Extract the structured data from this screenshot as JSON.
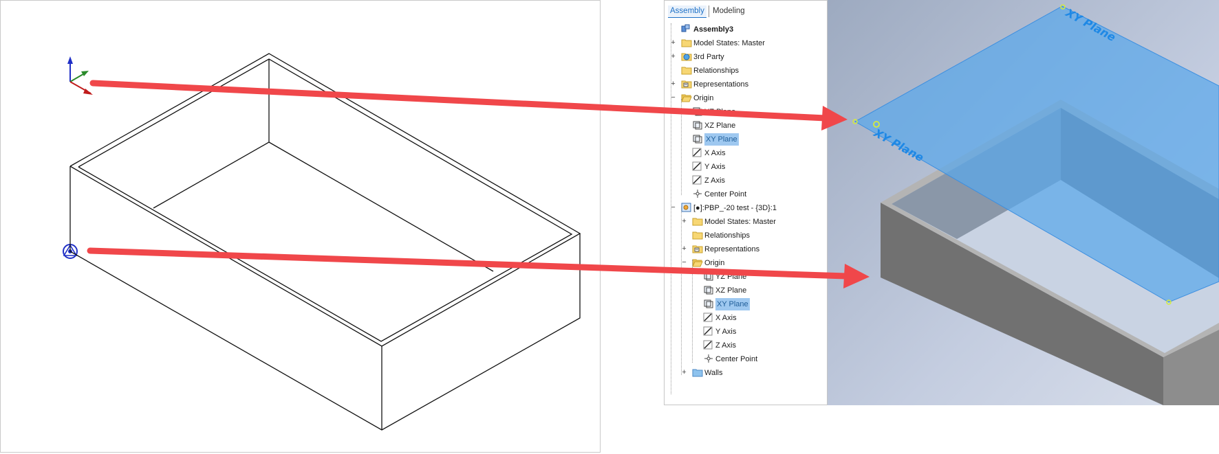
{
  "browser": {
    "tabs": [
      {
        "label": "Assembly",
        "active": true
      },
      {
        "label": "Modeling",
        "active": false
      }
    ],
    "tree": [
      {
        "label": "Assembly3",
        "icon": "assembly-icon",
        "bold": true
      },
      {
        "label": "Model States: Master",
        "icon": "folder-icon",
        "expander": "+"
      },
      {
        "label": "3rd Party",
        "icon": "third-party-icon",
        "expander": "+"
      },
      {
        "label": "Relationships",
        "icon": "folder-icon"
      },
      {
        "label": "Representations",
        "icon": "representations-icon",
        "expander": "+"
      },
      {
        "label": "Origin",
        "icon": "folder-open-icon",
        "expander": "−"
      },
      {
        "label": "YZ Plane",
        "icon": "plane-icon"
      },
      {
        "label": "XZ Plane",
        "icon": "plane-icon"
      },
      {
        "label": "XY Plane",
        "icon": "plane-icon",
        "selected": true
      },
      {
        "label": "X Axis",
        "icon": "axis-icon"
      },
      {
        "label": "Y Axis",
        "icon": "axis-icon"
      },
      {
        "label": "Z Axis",
        "icon": "axis-icon"
      },
      {
        "label": "Center Point",
        "icon": "center-point-icon"
      },
      {
        "label": "[●]:PBP_-20 test - {3D}:1",
        "icon": "part-icon",
        "expander": "−"
      },
      {
        "label": "Model States: Master",
        "icon": "folder-icon",
        "expander": "+"
      },
      {
        "label": "Relationships",
        "icon": "folder-icon"
      },
      {
        "label": "Representations",
        "icon": "representations-icon",
        "expander": "+"
      },
      {
        "label": "Origin",
        "icon": "folder-open-icon",
        "expander": "−"
      },
      {
        "label": "YZ Plane",
        "icon": "plane-icon"
      },
      {
        "label": "XZ Plane",
        "icon": "plane-icon"
      },
      {
        "label": "XY Plane",
        "icon": "plane-icon",
        "selected": true
      },
      {
        "label": "X Axis",
        "icon": "axis-icon"
      },
      {
        "label": "Y Axis",
        "icon": "axis-icon"
      },
      {
        "label": "Z Axis",
        "icon": "axis-icon"
      },
      {
        "label": "Center Point",
        "icon": "center-point-icon"
      },
      {
        "label": "Walls",
        "icon": "folder-blue-icon",
        "expander": "+"
      }
    ]
  },
  "viewport": {
    "plane_label": "XY Plane",
    "plane_color": "#5aa8ea",
    "label_color": "#1e88e5"
  },
  "annotations": {
    "arrow_color": "#f0474a"
  }
}
